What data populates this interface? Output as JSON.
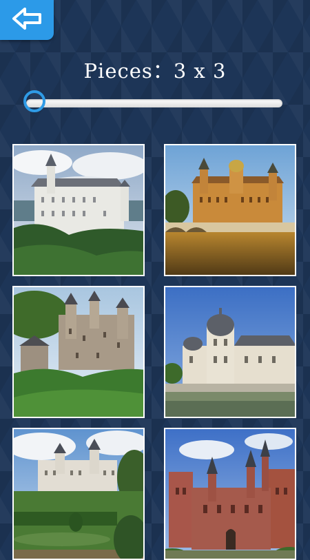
{
  "header": {
    "back_icon": "arrow-left-icon",
    "title": "Pieces：3 x 3"
  },
  "slider": {
    "level": 0
  },
  "puzzles": [
    {
      "name": "castle-1"
    },
    {
      "name": "castle-2"
    },
    {
      "name": "castle-3"
    },
    {
      "name": "castle-4"
    },
    {
      "name": "castle-5"
    },
    {
      "name": "castle-6"
    }
  ],
  "colors": {
    "accent": "#2c9ae8",
    "background": "#1d3557"
  }
}
